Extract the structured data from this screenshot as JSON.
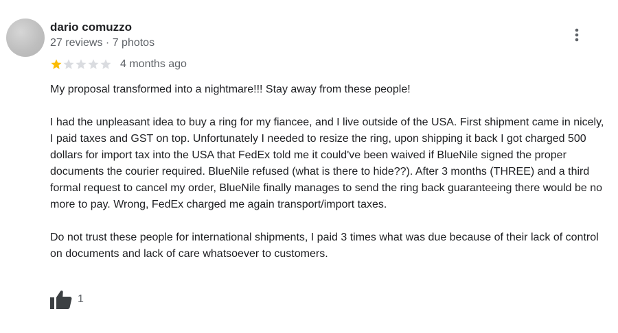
{
  "review": {
    "author": {
      "name": "dario comuzzo",
      "meta": "27 reviews · 7 photos"
    },
    "rating": {
      "value": 1,
      "max": 5,
      "filled_color": "#fbbc04",
      "empty_color": "#dadce0"
    },
    "time": "4 months ago",
    "paragraphs": [
      "My proposal transformed into a nightmare!!! Stay away from these people!",
      "I had the unpleasant idea to buy a ring for my fiancee, and I live outside of the USA. First shipment came in nicely, I paid taxes and GST on top. Unfortunately I needed to resize the ring, upon shipping it back I got charged 500 dollars for import tax into the USA that FedEx told me it could've been waived if BlueNile signed the proper documents the courier required. BlueNile refused (what is there to hide??). After 3 months (THREE) and a third formal request to cancel my order, BlueNile finally manages to send the ring back guaranteeing there would be no more to pay. Wrong, FedEx charged me again transport/import taxes.",
      "Do not trust these people for international shipments, I paid 3 times what was due because of their lack of control on documents and lack of care whatsoever to customers."
    ],
    "likes": "1",
    "icons": {
      "more": "more-vert-icon",
      "like": "thumbs-up-icon",
      "star": "star-icon"
    }
  }
}
